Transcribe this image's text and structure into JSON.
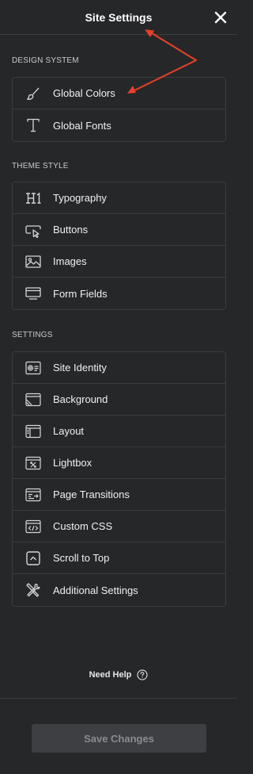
{
  "header": {
    "title": "Site Settings",
    "close_icon": "close-icon"
  },
  "sections": {
    "design_system": {
      "label": "DESIGN SYSTEM",
      "items": [
        {
          "label": "Global Colors",
          "icon": "brush-icon"
        },
        {
          "label": "Global Fonts",
          "icon": "font-icon"
        }
      ]
    },
    "theme_style": {
      "label": "THEME STYLE",
      "items": [
        {
          "label": "Typography",
          "icon": "heading-icon"
        },
        {
          "label": "Buttons",
          "icon": "button-icon"
        },
        {
          "label": "Images",
          "icon": "image-icon"
        },
        {
          "label": "Form Fields",
          "icon": "form-field-icon"
        }
      ]
    },
    "settings": {
      "label": "SETTINGS",
      "items": [
        {
          "label": "Site Identity",
          "icon": "site-identity-icon"
        },
        {
          "label": "Background",
          "icon": "background-icon"
        },
        {
          "label": "Layout",
          "icon": "layout-icon"
        },
        {
          "label": "Lightbox",
          "icon": "lightbox-icon"
        },
        {
          "label": "Page Transitions",
          "icon": "page-transitions-icon"
        },
        {
          "label": "Custom CSS",
          "icon": "code-icon"
        },
        {
          "label": "Scroll to Top",
          "icon": "scroll-top-icon"
        },
        {
          "label": "Additional Settings",
          "icon": "tools-icon"
        }
      ]
    }
  },
  "help": {
    "label": "Need Help",
    "icon": "help-icon"
  },
  "footer": {
    "save_label": "Save Changes",
    "save_disabled": true
  },
  "colors": {
    "background": "#262729",
    "border": "#3a3b3e",
    "annotation_arrow": "#e8402a",
    "save_button_bg": "#3e3f42",
    "save_button_text": "#8a8b8e"
  }
}
